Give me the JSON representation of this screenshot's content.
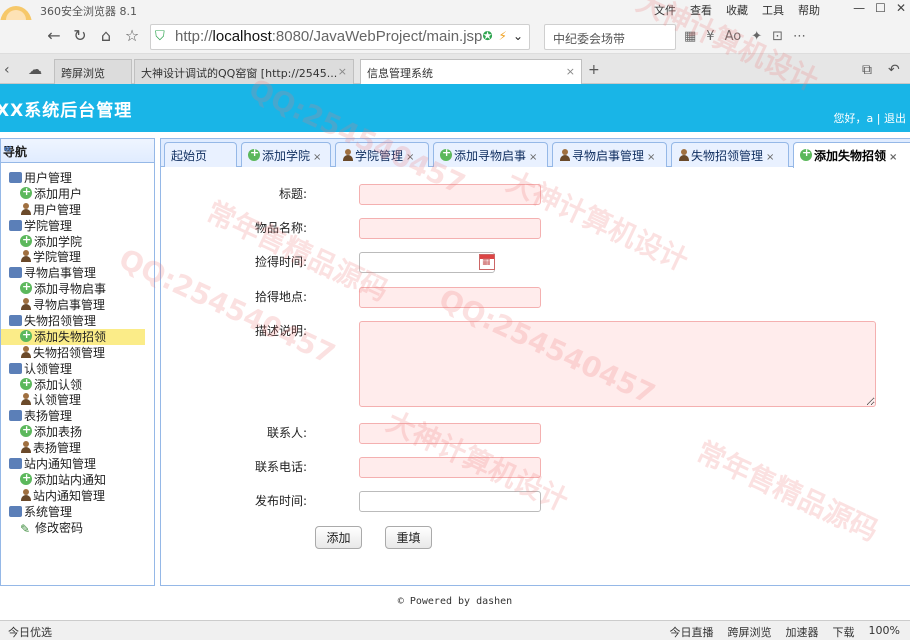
{
  "browser": {
    "app_title": "360安全浏览器 8.1",
    "menus": [
      "文件",
      "查看",
      "收藏",
      "工具",
      "帮助"
    ],
    "url_prefix": "http://",
    "url_host": "localhost",
    "url_rest": ":8080/JavaWebProject/main.jsp",
    "search_text": "中纪委会场带",
    "tabs": [
      {
        "label": "跨屏浏览"
      },
      {
        "label": "大神设计调试的QQ窑窗 [http://2545..."
      },
      {
        "label": "信息管理系统"
      }
    ]
  },
  "header": {
    "title": "XX系统后台管理",
    "greeting": "您好，a",
    "logout": "退出"
  },
  "sidebar": {
    "title": "导航",
    "collapse_icon": "«",
    "tree": [
      {
        "label": "用户管理",
        "level": 0,
        "icon": "folder-icon"
      },
      {
        "label": "添加用户",
        "level": 1,
        "icon": "add-icon"
      },
      {
        "label": "用户管理",
        "level": 1,
        "icon": "user-icon"
      },
      {
        "label": "学院管理",
        "level": 0,
        "icon": "folder-icon"
      },
      {
        "label": "添加学院",
        "level": 1,
        "icon": "add-icon"
      },
      {
        "label": "学院管理",
        "level": 1,
        "icon": "user-icon"
      },
      {
        "label": "寻物启事管理",
        "level": 0,
        "icon": "folder-icon"
      },
      {
        "label": "添加寻物启事",
        "level": 1,
        "icon": "add-icon"
      },
      {
        "label": "寻物启事管理",
        "level": 1,
        "icon": "user-icon"
      },
      {
        "label": "失物招领管理",
        "level": 0,
        "icon": "folder-icon"
      },
      {
        "label": "添加失物招领",
        "level": 1,
        "icon": "add-icon",
        "selected": true
      },
      {
        "label": "失物招领管理",
        "level": 1,
        "icon": "user-icon"
      },
      {
        "label": "认领管理",
        "level": 0,
        "icon": "folder-icon"
      },
      {
        "label": "添加认领",
        "level": 1,
        "icon": "add-icon"
      },
      {
        "label": "认领管理",
        "level": 1,
        "icon": "user-icon"
      },
      {
        "label": "表扬管理",
        "level": 0,
        "icon": "folder-icon"
      },
      {
        "label": "添加表扬",
        "level": 1,
        "icon": "add-icon"
      },
      {
        "label": "表扬管理",
        "level": 1,
        "icon": "user-icon"
      },
      {
        "label": "站内通知管理",
        "level": 0,
        "icon": "folder-icon"
      },
      {
        "label": "添加站内通知",
        "level": 1,
        "icon": "add-icon"
      },
      {
        "label": "站内通知管理",
        "level": 1,
        "icon": "user-icon"
      },
      {
        "label": "系统管理",
        "level": 0,
        "icon": "folder-icon"
      },
      {
        "label": "修改密码",
        "level": 1,
        "icon": "pencil-icon"
      }
    ]
  },
  "content_tabs": [
    {
      "label": "起始页",
      "icon": "none"
    },
    {
      "label": "添加学院",
      "icon": "add-icon"
    },
    {
      "label": "学院管理",
      "icon": "user-icon"
    },
    {
      "label": "添加寻物启事",
      "icon": "add-icon"
    },
    {
      "label": "寻物启事管理",
      "icon": "user-icon"
    },
    {
      "label": "失物招领管理",
      "icon": "user-icon"
    },
    {
      "label": "添加失物招领",
      "icon": "add-icon",
      "active": true
    }
  ],
  "form": {
    "title_label": "标题:",
    "item_name_label": "物品名称:",
    "found_time_label": "捡得时间:",
    "found_place_label": "拾得地点:",
    "description_label": "描述说明:",
    "contact_label": "联系人:",
    "phone_label": "联系电话:",
    "publish_time_label": "发布时间:",
    "title_value": "",
    "item_name_value": "",
    "found_time_value": "",
    "found_place_value": "",
    "description_value": "",
    "contact_value": "",
    "phone_value": "",
    "publish_time_value": "",
    "add_button": "添加",
    "reset_button": "重填"
  },
  "footer": "© Powered by dashen",
  "statusbar": {
    "left": "今日优选",
    "right": [
      "今日直播",
      "跨屏浏览",
      "加速器",
      "下载",
      "100%"
    ]
  },
  "watermarks": [
    "QQ:254540457",
    "大神计算机设计",
    "常年售精品源码"
  ],
  "colors": {
    "header_bg": "#19b5e7",
    "panel_border": "#95b8e7",
    "selected_bg": "#fbec88",
    "required_field_bg": "#ffecec"
  }
}
